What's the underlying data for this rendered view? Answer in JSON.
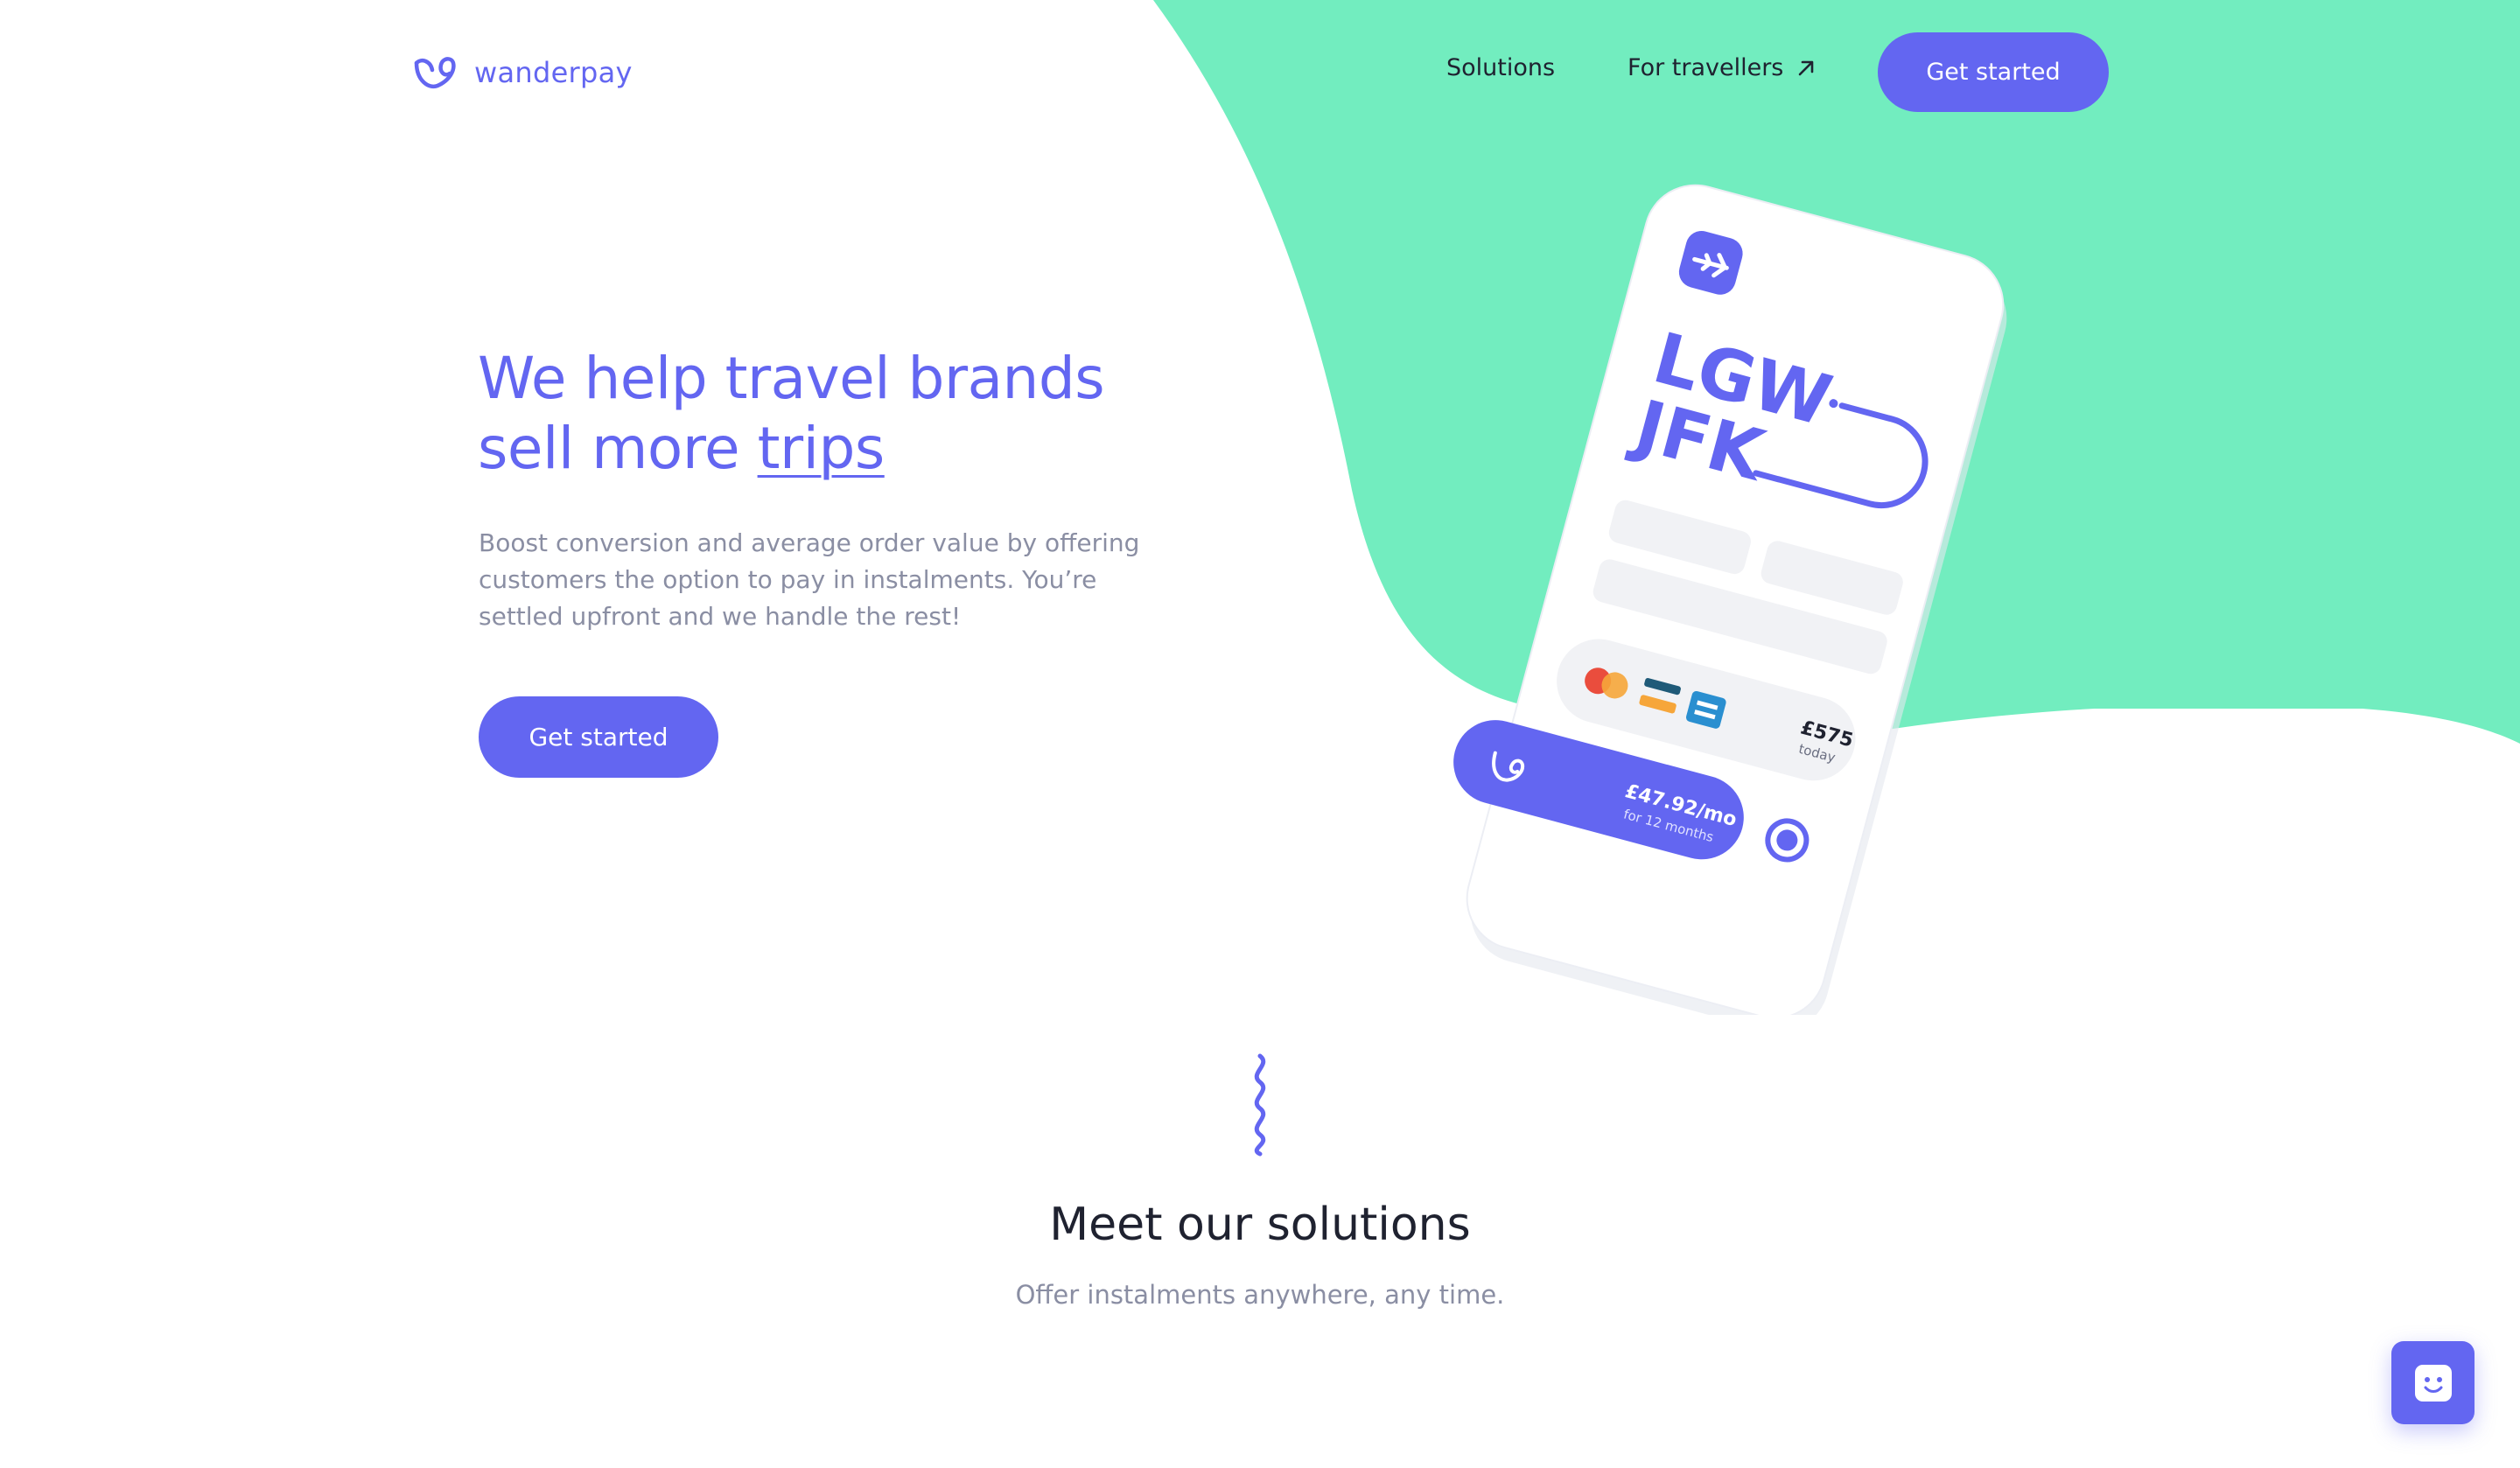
{
  "colors": {
    "accent": "#6366f1",
    "mint": "#72edbf",
    "text_dark": "#1f2230",
    "text_muted": "#8a8ea3"
  },
  "header": {
    "logo_text": "wanderpay",
    "nav": [
      {
        "label": "Solutions"
      },
      {
        "label": "For travellers",
        "icon": "arrow-up-right-icon"
      }
    ],
    "cta_label": "Get started"
  },
  "hero": {
    "title_line1": "We help travel brands",
    "title_line2_prefix": "sell more",
    "title_line2_link": "trips",
    "description": "Boost conversion and average order value by offering customers the option to pay in instalments. You’re settled upfront and we handle the rest!",
    "cta_label": "Get started"
  },
  "phone": {
    "origin": "LGW",
    "destination": "JFK",
    "pay_today_amount": "£575",
    "pay_today_label": "today",
    "monthly_amount": "£47.92/mo",
    "monthly_term": "for 12 months"
  },
  "solutions": {
    "title": "Meet our solutions",
    "subtitle": "Offer instalments anywhere, any time."
  },
  "chat": {
    "icon": "chat-smiley-icon"
  }
}
